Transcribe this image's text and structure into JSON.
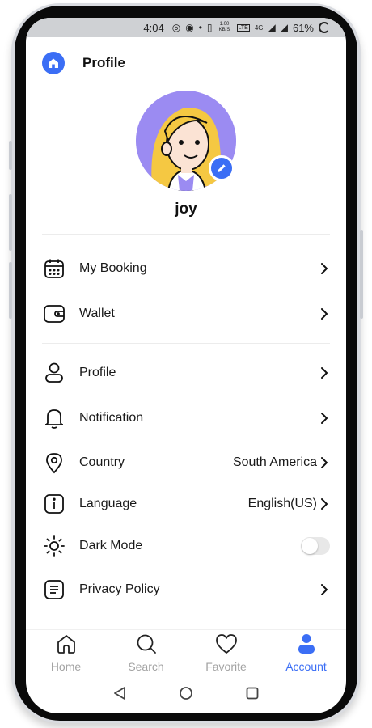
{
  "status_bar": {
    "time": "4:04",
    "network_speed": "1.00 KB/S",
    "network_type": "4G",
    "battery": "61%"
  },
  "header": {
    "title": "Profile"
  },
  "profile": {
    "username": "joy"
  },
  "menu": [
    {
      "label": "My Booking",
      "icon": "calendar-icon"
    },
    {
      "label": "Wallet",
      "icon": "wallet-icon"
    },
    {
      "label": "Profile",
      "icon": "user-icon"
    },
    {
      "label": "Notification",
      "icon": "bell-icon"
    },
    {
      "label": "Country",
      "value": "South America",
      "icon": "location-icon"
    },
    {
      "label": "Language",
      "value": "English(US)",
      "icon": "info-icon"
    },
    {
      "label": "Dark Mode",
      "icon": "sun-icon",
      "toggle_on": false
    },
    {
      "label": "Privacy Policy",
      "icon": "document-icon"
    }
  ],
  "bottom_nav": [
    {
      "label": "Home",
      "icon": "home-icon",
      "active": false
    },
    {
      "label": "Search",
      "icon": "search-icon",
      "active": false
    },
    {
      "label": "Favorite",
      "icon": "heart-icon",
      "active": false
    },
    {
      "label": "Account",
      "icon": "account-icon",
      "active": true
    }
  ],
  "colors": {
    "accent": "#3b6ef5",
    "inactive": "#a3a3a3",
    "avatar_bg": "#9b8bf2"
  }
}
